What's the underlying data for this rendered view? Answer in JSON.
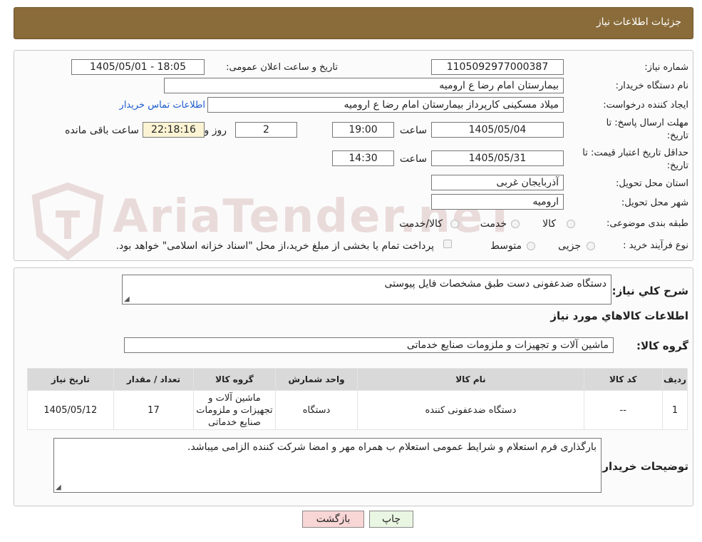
{
  "header": {
    "title": "جزئیات اطلاعات نیاز"
  },
  "watermark": {
    "text": "AriaTender.neT"
  },
  "form": {
    "need_number": {
      "label": "شماره نیاز:",
      "value": "1105092977000387"
    },
    "announce": {
      "label": "تاریخ و ساعت اعلان عمومی:",
      "value": "1405/05/01 - 18:05"
    },
    "buyer_org": {
      "label": "نام دستگاه خریدار:",
      "value": "بیمارستان امام رضا  ع  ارومیه"
    },
    "requester": {
      "label": "ایجاد کننده درخواست:",
      "value": "میلاد مسکینی کارپرداز بیمارستان امام رضا  ع  ارومیه",
      "contact_link": "اطلاعات تماس خریدار"
    },
    "deadline": {
      "label_line1": "مهلت ارسال پاسخ: تا",
      "label_line2": "تاریخ:",
      "date": "1405/05/04",
      "time_label": "ساعت",
      "time": "19:00",
      "days": "2",
      "days_label": "روز و",
      "remaining": "22:18:16",
      "remaining_label": "ساعت باقی مانده"
    },
    "validity": {
      "label_line1": "حداقل تاریخ اعتبار قیمت: تا",
      "label_line2": "تاریخ:",
      "date": "1405/05/31",
      "time_label": "ساعت",
      "time": "14:30"
    },
    "province": {
      "label": "استان محل تحویل:",
      "value": "آذربایجان غربی"
    },
    "city": {
      "label": "شهر محل تحویل:",
      "value": "ارومیه"
    },
    "category": {
      "label": "طبقه بندی موضوعی:",
      "options": [
        "کالا",
        "خدمت",
        "کالا/خدمت"
      ]
    },
    "process": {
      "label": "نوع فرآیند خرید :",
      "options": [
        "جزیی",
        "متوسط"
      ],
      "note": "پرداخت تمام یا بخشی از مبلغ خرید،از محل \"اسناد خزانه اسلامی\" خواهد بود."
    }
  },
  "details": {
    "summary_label": "شرح کلي نياز:",
    "summary_value": "دستگاه ضدعفونی دست طبق مشخصات فایل پیوستی",
    "goods_title": "اطلاعات کالاهاي مورد نياز",
    "group_label": "گروه کالا:",
    "group_value": "ماشین آلات و تجهیزات و ملزومات صنایع خدماتی",
    "table": {
      "headers": [
        "رديف",
        "کد کالا",
        "نام کالا",
        "واحد شمارش",
        "گروه کالا",
        "تعداد / مقدار",
        "تاریخ نیاز"
      ],
      "rows": [
        {
          "row": "1",
          "code": "--",
          "name": "دستگاه ضدعفونی کننده",
          "unit": "دستگاه",
          "group": "ماشین آلات و تجهیزات و ملزومات صنایع خدماتی",
          "qty": "17",
          "date": "1405/05/12"
        }
      ]
    },
    "buyer_notes_label": "توضیحات خریدار:",
    "buyer_notes_value": "بارگذاری فرم استعلام و شرایط عمومی استعلام ب همراه مهر و امضا شرکت کننده الزامی میباشد."
  },
  "buttons": {
    "print": "چاپ",
    "back": "بازگشت"
  },
  "colors": {
    "header": "#8a6c3b",
    "link": "#1a5ccf",
    "remaining_bg": "#fbf3d3",
    "back_btn": "#f9d6d6",
    "print_btn": "#e9f6e2"
  }
}
